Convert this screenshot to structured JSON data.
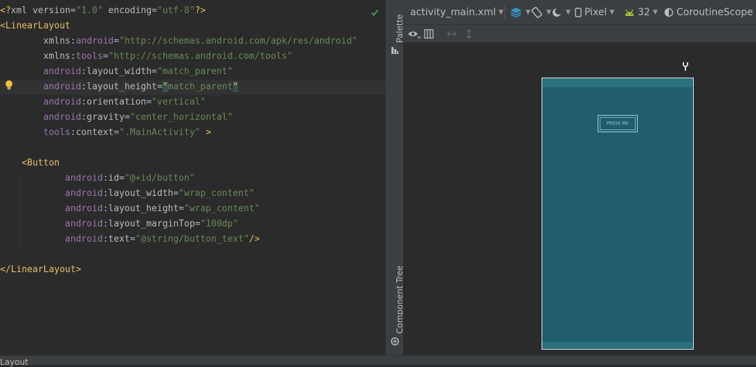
{
  "editor": {
    "lines": [
      {
        "segs": [
          {
            "c": "pi",
            "t": "<?"
          },
          {
            "c": "at",
            "t": "xml version"
          },
          {
            "c": "",
            "t": "="
          },
          {
            "c": "str",
            "t": "\"1.0\""
          },
          {
            "c": "at",
            "t": " encoding"
          },
          {
            "c": "",
            "t": "="
          },
          {
            "c": "str",
            "t": "\"utf-8\""
          },
          {
            "c": "pi",
            "t": "?>"
          }
        ]
      },
      {
        "segs": [
          {
            "c": "tag",
            "t": "<LinearLayout"
          }
        ]
      },
      {
        "segs": [
          {
            "c": "",
            "t": "        "
          },
          {
            "c": "at",
            "t": "xmlns"
          },
          {
            "c": "",
            "t": ":"
          },
          {
            "c": "ns",
            "t": "android"
          },
          {
            "c": "",
            "t": "="
          },
          {
            "c": "str",
            "t": "\"http://schemas.android.com/apk/res/android\""
          }
        ]
      },
      {
        "segs": [
          {
            "c": "",
            "t": "        "
          },
          {
            "c": "at",
            "t": "xmlns"
          },
          {
            "c": "",
            "t": ":"
          },
          {
            "c": "ns",
            "t": "tools"
          },
          {
            "c": "",
            "t": "="
          },
          {
            "c": "str",
            "t": "\"http://schemas.android.com/tools\""
          }
        ]
      },
      {
        "segs": [
          {
            "c": "",
            "t": "        "
          },
          {
            "c": "ns",
            "t": "android"
          },
          {
            "c": "",
            "t": ":"
          },
          {
            "c": "at",
            "t": "layout_width"
          },
          {
            "c": "",
            "t": "="
          },
          {
            "c": "str",
            "t": "\"match_parent\""
          }
        ]
      },
      {
        "cur": true,
        "segs": [
          {
            "c": "",
            "t": "        "
          },
          {
            "c": "ns",
            "t": "android"
          },
          {
            "c": "",
            "t": ":"
          },
          {
            "c": "at",
            "t": "layout_height"
          },
          {
            "c": "",
            "t": "="
          },
          {
            "c": "q-hl",
            "t": "\""
          },
          {
            "c": "str",
            "t": "match_parent"
          },
          {
            "c": "q-hl",
            "t": "\""
          }
        ]
      },
      {
        "segs": [
          {
            "c": "",
            "t": "        "
          },
          {
            "c": "ns",
            "t": "android"
          },
          {
            "c": "",
            "t": ":"
          },
          {
            "c": "at",
            "t": "orientation"
          },
          {
            "c": "",
            "t": "="
          },
          {
            "c": "str",
            "t": "\"vertical\""
          }
        ]
      },
      {
        "segs": [
          {
            "c": "",
            "t": "        "
          },
          {
            "c": "ns",
            "t": "android"
          },
          {
            "c": "",
            "t": ":"
          },
          {
            "c": "at",
            "t": "gravity"
          },
          {
            "c": "",
            "t": "="
          },
          {
            "c": "str",
            "t": "\"center_horizontal\""
          }
        ]
      },
      {
        "segs": [
          {
            "c": "",
            "t": "        "
          },
          {
            "c": "ns",
            "t": "tools"
          },
          {
            "c": "",
            "t": ":"
          },
          {
            "c": "at",
            "t": "context"
          },
          {
            "c": "",
            "t": "="
          },
          {
            "c": "str",
            "t": "\".MainActivity\""
          },
          {
            "c": "tag",
            "t": " >"
          }
        ]
      },
      {
        "segs": []
      },
      {
        "segs": [
          {
            "c": "",
            "t": "    "
          },
          {
            "c": "tag",
            "t": "<Button"
          }
        ]
      },
      {
        "segs": [
          {
            "c": "",
            "t": "            "
          },
          {
            "c": "ns",
            "t": "android"
          },
          {
            "c": "",
            "t": ":"
          },
          {
            "c": "at",
            "t": "id"
          },
          {
            "c": "",
            "t": "="
          },
          {
            "c": "str",
            "t": "\"@+id/button\""
          }
        ]
      },
      {
        "segs": [
          {
            "c": "",
            "t": "            "
          },
          {
            "c": "ns",
            "t": "android"
          },
          {
            "c": "",
            "t": ":"
          },
          {
            "c": "at",
            "t": "layout_width"
          },
          {
            "c": "",
            "t": "="
          },
          {
            "c": "str",
            "t": "\"wrap_content\""
          }
        ]
      },
      {
        "segs": [
          {
            "c": "",
            "t": "            "
          },
          {
            "c": "ns",
            "t": "android"
          },
          {
            "c": "",
            "t": ":"
          },
          {
            "c": "at",
            "t": "layout_height"
          },
          {
            "c": "",
            "t": "="
          },
          {
            "c": "str",
            "t": "\"wrap_content\""
          }
        ]
      },
      {
        "segs": [
          {
            "c": "",
            "t": "            "
          },
          {
            "c": "ns",
            "t": "android"
          },
          {
            "c": "",
            "t": ":"
          },
          {
            "c": "at",
            "t": "layout_marginTop"
          },
          {
            "c": "",
            "t": "="
          },
          {
            "c": "str",
            "t": "\"100dp\""
          }
        ]
      },
      {
        "segs": [
          {
            "c": "",
            "t": "            "
          },
          {
            "c": "ns",
            "t": "android"
          },
          {
            "c": "",
            "t": ":"
          },
          {
            "c": "at",
            "t": "text"
          },
          {
            "c": "",
            "t": "="
          },
          {
            "c": "str",
            "t": "\"@string/button_text\""
          },
          {
            "c": "tag",
            "t": "/>"
          }
        ]
      },
      {
        "segs": []
      },
      {
        "segs": [
          {
            "c": "tag",
            "t": "</LinearLayout>"
          }
        ]
      }
    ]
  },
  "side_tabs": {
    "palette": "Palette",
    "component_tree": "Component Tree"
  },
  "toolbar": {
    "file_name": "activity_main.xml",
    "device": "Pixel",
    "api_level": "32",
    "theme": "CoroutineScope"
  },
  "preview": {
    "button_text": "PRESS ME"
  },
  "bottom_bar": {
    "label": "Layout"
  },
  "colors": {
    "device_bg": "#215e6d",
    "accent_green": "#a4c639",
    "check_green": "#499c54"
  }
}
